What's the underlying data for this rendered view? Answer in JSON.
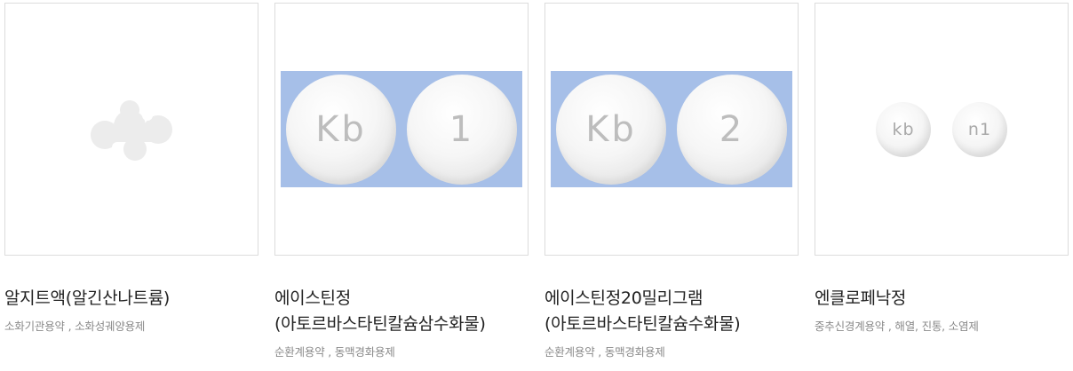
{
  "products": [
    {
      "name_line1": "알지트액(알긴산나트륨)",
      "name_line2": "",
      "category": "소화기관용약 , 소화성궤양용제",
      "image": "placeholder-logo-icon"
    },
    {
      "name_line1": "에이스틴정",
      "name_line2": "(아토르바스타틴칼슘삼수화물)",
      "category": "순환계용약 , 동맥경화용제",
      "pill_marks": [
        "Kb",
        "1"
      ]
    },
    {
      "name_line1": "에이스틴정20밀리그램",
      "name_line2": "(아토르바스타틴칼슘수화물)",
      "category": "순환계용약 , 동맥경화용제",
      "pill_marks": [
        "Kb",
        "2"
      ]
    },
    {
      "name_line1": "엔클로페낙정",
      "name_line2": "",
      "category": "중추신경계용약 , 해열, 진통, 소염제",
      "pill_marks": [
        "kb",
        "n1"
      ]
    }
  ]
}
